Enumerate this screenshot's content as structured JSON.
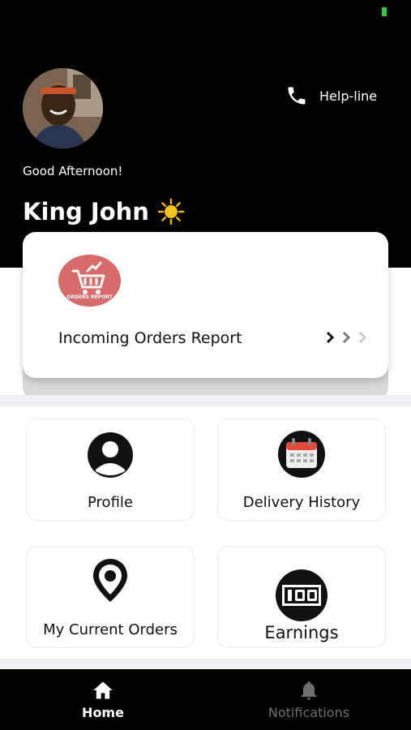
{
  "header": {
    "greeting": "Good Afternoon!",
    "user_name": "King John",
    "helpline_label": "Help-line"
  },
  "report_card": {
    "title": "Incoming Orders Report",
    "logo_text": "ORDERS REPORT",
    "logo_color": "#d96a6a"
  },
  "tiles": [
    {
      "label": "Profile",
      "icon": "profile-icon"
    },
    {
      "label": "Delivery History",
      "icon": "calendar-icon"
    },
    {
      "label": "My Current Orders",
      "icon": "location-pin-icon"
    },
    {
      "label": "Earnings",
      "icon": "cash-icon"
    }
  ],
  "tabbar": {
    "home_label": "Home",
    "notifications_label": "Notifications"
  },
  "colors": {
    "header_bg": "#000000",
    "active_tab": "#ffffff",
    "inactive_tab": "#6e6e6e"
  }
}
